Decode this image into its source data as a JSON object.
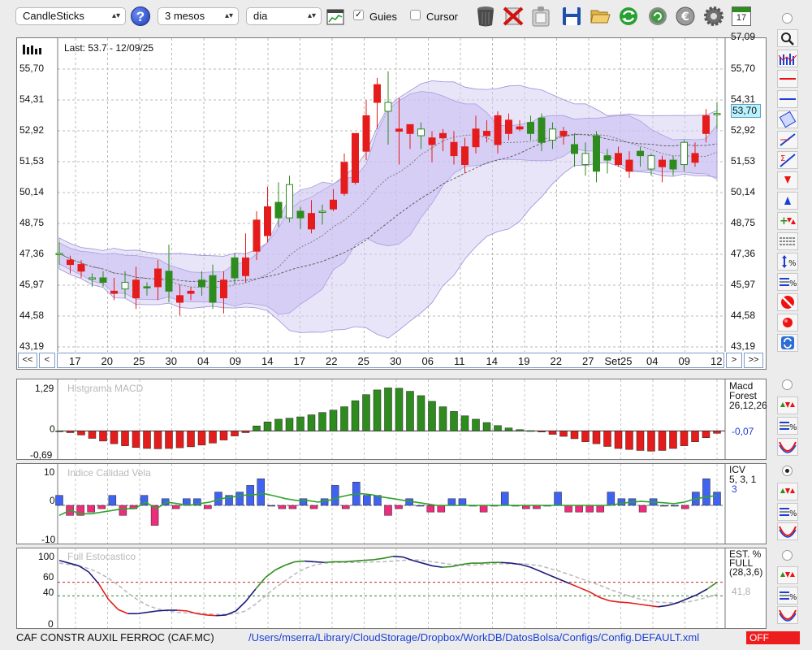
{
  "toolbar": {
    "chart_type": "CandleSticks",
    "period": "3 mesos",
    "interval": "dia",
    "guides_label": "Guies",
    "guides_checked": true,
    "cursor_label": "Cursor",
    "cursor_checked": false,
    "help_label": "?",
    "calendar_label": "17",
    "icons": [
      "help-icon",
      "chart-view-icon",
      "trash-icon",
      "delete-icon",
      "clip-icon",
      "save-icon",
      "folder-open-icon",
      "refresh-icon",
      "update-icon",
      "euro-icon",
      "settings-icon",
      "calendar-icon"
    ]
  },
  "price_panel": {
    "last_label": "Last: 53.7 - 12/09/25",
    "current_price": "53,70",
    "y_ticks": [
      "55,70",
      "54,31",
      "52,92",
      "51,53",
      "50,14",
      "48,75",
      "47,36",
      "45,97",
      "44,58",
      "43,19"
    ],
    "y_top_partial": "57,09",
    "x_labels": [
      "17",
      "20",
      "25",
      "30",
      "04",
      "09",
      "14",
      "17",
      "22",
      "25",
      "30",
      "06",
      "11",
      "14",
      "19",
      "22",
      "27",
      "Set25",
      "04",
      "09",
      "12"
    ],
    "nav": {
      "first": "<<",
      "prev": "<",
      "next": ">",
      "last": ">>"
    }
  },
  "macd_panel": {
    "title": "Histgrama MACD",
    "name": "Macd",
    "variant": "Forest",
    "params": "26,12,26",
    "value": "-0,07",
    "y_ticks": [
      "1,29",
      "0",
      "-0,69"
    ]
  },
  "icv_panel": {
    "title": "Indice Calidad Vela",
    "name": "ICV",
    "params": "5, 3, 1",
    "value": "3",
    "y_ticks": [
      "10",
      "0",
      "-10"
    ]
  },
  "stoch_panel": {
    "title": "Full Estocastico",
    "name": "EST. %",
    "variant": "FULL",
    "params": "(28,3,6)",
    "value": "41,8",
    "y_ticks": [
      "100",
      "60",
      "40",
      "0"
    ]
  },
  "status": {
    "company": "CAF CONSTR AUXIL FERROC (CAF.MC)",
    "path": "/Users/mserra/Library/CloudStorage/Dropbox/WorkDB/DatosBolsa/Configs/Config.DEFAULT.xml",
    "state": "OFF"
  },
  "colors": {
    "up": "#2e8b1e",
    "down": "#e51c1c",
    "band": "#d7cff4",
    "accent": "#1b3fd6"
  },
  "chart_data": [
    {
      "type": "candlestick",
      "title": "",
      "ylim": [
        43.19,
        57.09
      ],
      "open": [
        47.4,
        47.1,
        46.9,
        46.3,
        46.1,
        45.7,
        45.8,
        46.2,
        45.9,
        46.7,
        45.7,
        45.5,
        45.7,
        45.9,
        45.2,
        46.2,
        46.3,
        47.2,
        48.9,
        49.5,
        49.0,
        49.0,
        49.0,
        49.2,
        49.3,
        49.8,
        51.5,
        52.8,
        53.6,
        55.0,
        53.8,
        53.0,
        53.2,
        52.7,
        52.6,
        52.8,
        52.4,
        52.2,
        53.0,
        52.9,
        53.6,
        53.4,
        53.1,
        52.8,
        52.4,
        52.5,
        52.9,
        51.9,
        51.4,
        51.1,
        51.6,
        51.9,
        51.6,
        51.8,
        51.2,
        51.6,
        51.2,
        51.4,
        51.9,
        53.6,
        53.7
      ],
      "close": [
        47.4,
        46.9,
        46.6,
        46.3,
        46.3,
        45.6,
        46.1,
        45.4,
        45.9,
        45.9,
        46.6,
        45.2,
        45.6,
        46.2,
        46.4,
        45.4,
        47.2,
        46.4,
        47.5,
        48.2,
        49.7,
        50.5,
        49.3,
        48.5,
        49.3,
        49.4,
        50.1,
        50.6,
        52.0,
        54.2,
        54.2,
        52.9,
        52.8,
        53.0,
        52.3,
        52.6,
        51.8,
        51.4,
        52.2,
        52.7,
        52.3,
        52.8,
        53.0,
        53.3,
        53.5,
        53.0,
        52.7,
        52.3,
        51.9,
        52.7,
        51.8,
        51.4,
        51.1,
        52.0,
        51.8,
        51.3,
        51.6,
        52.4,
        51.5,
        52.8,
        53.7
      ],
      "high": [
        47.9,
        47.3,
        47.1,
        46.5,
        46.6,
        46.3,
        46.6,
        46.8,
        46.1,
        47.1,
        47.8,
        46.0,
        45.9,
        46.6,
        46.9,
        46.6,
        47.4,
        48.3,
        49.3,
        50.4,
        50.6,
        50.9,
        49.5,
        49.8,
        49.6,
        50.3,
        51.9,
        52.8,
        54.3,
        55.3,
        55.6,
        54.4,
        53.2,
        53.3,
        52.9,
        53.0,
        52.9,
        52.6,
        53.6,
        53.4,
        53.8,
        53.7,
        53.4,
        53.6,
        53.7,
        53.3,
        53.1,
        52.8,
        52.4,
        52.9,
        52.1,
        52.2,
        52.0,
        52.2,
        51.9,
        51.8,
        51.8,
        52.5,
        52.4,
        53.9,
        54.2
      ],
      "low": [
        46.9,
        46.5,
        46.3,
        45.9,
        45.9,
        45.3,
        45.4,
        44.9,
        45.5,
        45.3,
        45.2,
        44.6,
        45.3,
        45.5,
        44.9,
        44.7,
        46.0,
        46.1,
        47.1,
        47.9,
        48.6,
        48.8,
        48.5,
        48.3,
        48.7,
        49.3,
        50.0,
        50.5,
        51.6,
        53.0,
        52.3,
        51.4,
        52.1,
        52.1,
        51.5,
        52.0,
        51.4,
        51.0,
        51.9,
        52.4,
        51.9,
        52.5,
        52.9,
        52.5,
        52.0,
        52.1,
        52.3,
        51.3,
        50.9,
        50.6,
        51.0,
        51.3,
        50.8,
        51.3,
        50.9,
        50.6,
        50.9,
        51.1,
        51.3,
        52.4,
        53.0
      ]
    },
    {
      "type": "bar",
      "title": "Histgrama MACD",
      "ylim": [
        -0.69,
        1.29
      ],
      "values": [
        0.0,
        -0.05,
        -0.12,
        -0.22,
        -0.3,
        -0.38,
        -0.44,
        -0.49,
        -0.52,
        -0.53,
        -0.52,
        -0.5,
        -0.47,
        -0.42,
        -0.36,
        -0.27,
        -0.15,
        -0.05,
        0.15,
        0.27,
        0.35,
        0.38,
        0.42,
        0.48,
        0.55,
        0.62,
        0.72,
        0.9,
        1.08,
        1.22,
        1.28,
        1.27,
        1.18,
        1.05,
        0.88,
        0.72,
        0.58,
        0.45,
        0.35,
        0.25,
        0.16,
        0.09,
        0.04,
        0.01,
        -0.03,
        -0.1,
        -0.16,
        -0.23,
        -0.32,
        -0.38,
        -0.46,
        -0.52,
        -0.55,
        -0.58,
        -0.6,
        -0.58,
        -0.52,
        -0.44,
        -0.32,
        -0.2,
        -0.07
      ]
    },
    {
      "type": "bar",
      "title": "Indice Calidad Vela",
      "ylim": [
        -10,
        10
      ],
      "values": [
        3,
        -3,
        -3,
        -2,
        -1,
        3,
        -3,
        -1,
        3,
        -6,
        2,
        -1,
        2,
        2,
        -1,
        4,
        3,
        4,
        6,
        8,
        0,
        -1,
        -1,
        2,
        -1,
        2,
        6,
        -1,
        7,
        3,
        3,
        -3,
        -1,
        2,
        0,
        -2,
        -2,
        2,
        2,
        0,
        -2,
        0,
        4,
        0,
        -1,
        -1,
        0,
        4,
        -2,
        -2,
        -2,
        -2,
        4,
        2,
        2,
        -2,
        2,
        0,
        0,
        -1,
        4,
        8,
        4
      ],
      "series": [
        {
          "name": "ICV",
          "values": [
            -3,
            -1.5,
            -2.5,
            -2.5,
            -2,
            -1.5,
            -1,
            -1,
            1,
            -1,
            1,
            0.5,
            0,
            0.5,
            1,
            2,
            2.5,
            3,
            3.2,
            3.5,
            2.8,
            2,
            1.5,
            1.5,
            1,
            1.5,
            2.5,
            3.2,
            3.5,
            3.2,
            2.5,
            2,
            1.5,
            1,
            0.5,
            0,
            0,
            0,
            0,
            0,
            0,
            0,
            0,
            0,
            0,
            0,
            0,
            0,
            0,
            0,
            0,
            0,
            0.5,
            1,
            1.2,
            1,
            0.8,
            0.5,
            1,
            2,
            2.5,
            3
          ]
        }
      ]
    },
    {
      "type": "line",
      "title": "Full Estocastico",
      "ylim": [
        0,
        100
      ],
      "series": [
        {
          "name": "EST. %",
          "values": [
            92,
            88,
            84,
            75,
            58,
            35,
            20,
            14,
            14,
            16,
            18,
            19,
            19,
            18,
            14,
            12,
            11,
            12,
            18,
            32,
            50,
            67,
            78,
            85,
            90,
            91,
            90,
            89,
            90,
            90,
            91,
            92,
            93,
            95,
            98,
            97,
            92,
            88,
            84,
            82,
            83,
            86,
            88,
            88,
            89,
            89,
            88,
            86,
            82,
            76,
            70,
            64,
            58,
            52,
            46,
            38,
            33,
            31,
            30,
            28,
            26,
            24,
            26,
            30,
            36,
            42,
            50,
            60
          ]
        },
        {
          "name": "",
          "values": [
            88,
            86,
            84,
            80,
            74,
            66,
            56,
            44,
            34,
            26,
            21,
            18,
            16,
            15,
            15,
            14,
            13,
            13,
            14,
            18,
            28,
            40,
            52,
            62,
            72,
            80,
            85,
            88,
            89,
            89,
            89,
            89,
            90,
            90,
            91,
            92,
            93,
            92,
            90,
            88,
            86,
            85,
            85,
            86,
            87,
            87,
            87,
            87,
            86,
            84,
            80,
            76,
            71,
            66,
            61,
            56,
            50,
            45,
            40,
            36,
            33,
            31,
            30,
            30,
            31,
            34,
            38,
            42
          ]
        }
      ]
    }
  ]
}
